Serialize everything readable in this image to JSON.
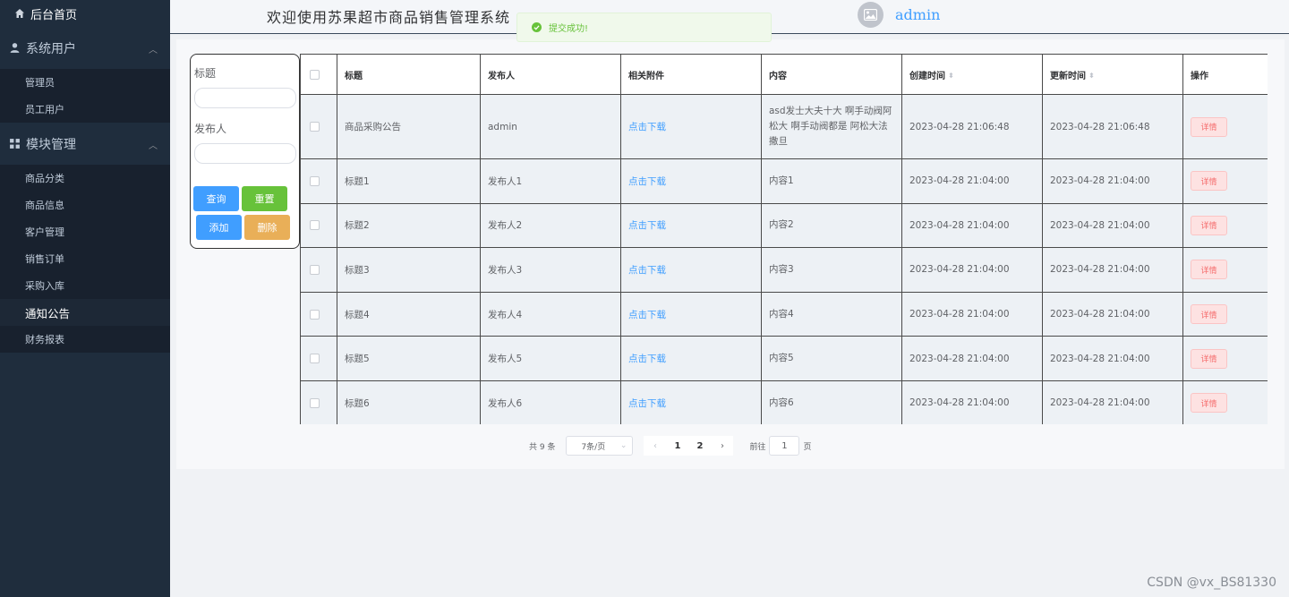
{
  "sidebar": {
    "home": {
      "label": "后台首页",
      "icon": "home-icon"
    },
    "groups": [
      {
        "label": "系统用户",
        "icon": "user-icon",
        "items": [
          "管理员",
          "员工用户"
        ]
      },
      {
        "label": "模块管理",
        "icon": "grid-icon",
        "items": [
          "商品分类",
          "商品信息",
          "客户管理",
          "销售订单",
          "采购入库",
          "通知公告",
          "财务报表"
        ]
      }
    ],
    "active_item": "通知公告"
  },
  "header": {
    "title": "欢迎使用苏果超市商品销售管理系统",
    "username": "admin"
  },
  "toast": {
    "message": "提交成功!",
    "color": "#67c23a"
  },
  "search": {
    "title_label": "标题",
    "publisher_label": "发布人",
    "buttons": {
      "query": "查询",
      "reset": "重置",
      "add": "添加",
      "delete": "删除"
    }
  },
  "table": {
    "headers": [
      "标题",
      "发布人",
      "相关附件",
      "内容",
      "创建时间",
      "更新时间",
      "操作"
    ],
    "rows": [
      {
        "title": "商品采购公告",
        "publisher": "admin",
        "attachment": "点击下载",
        "content": "asd发士大夫十大 啊手动阀阿松大 啊手动阀都是 阿松大法撒旦",
        "created": "2023-04-28 21:06:48",
        "updated": "2023-04-28 21:06:48",
        "action": "详情"
      },
      {
        "title": "标题1",
        "publisher": "发布人1",
        "attachment": "点击下载",
        "content": "内容1",
        "created": "2023-04-28 21:04:00",
        "updated": "2023-04-28 21:04:00",
        "action": "详情"
      },
      {
        "title": "标题2",
        "publisher": "发布人2",
        "attachment": "点击下载",
        "content": "内容2",
        "created": "2023-04-28 21:04:00",
        "updated": "2023-04-28 21:04:00",
        "action": "详情"
      },
      {
        "title": "标题3",
        "publisher": "发布人3",
        "attachment": "点击下载",
        "content": "内容3",
        "created": "2023-04-28 21:04:00",
        "updated": "2023-04-28 21:04:00",
        "action": "详情"
      },
      {
        "title": "标题4",
        "publisher": "发布人4",
        "attachment": "点击下载",
        "content": "内容4",
        "created": "2023-04-28 21:04:00",
        "updated": "2023-04-28 21:04:00",
        "action": "详情"
      },
      {
        "title": "标题5",
        "publisher": "发布人5",
        "attachment": "点击下载",
        "content": "内容5",
        "created": "2023-04-28 21:04:00",
        "updated": "2023-04-28 21:04:00",
        "action": "详情"
      },
      {
        "title": "标题6",
        "publisher": "发布人6",
        "attachment": "点击下载",
        "content": "内容6",
        "created": "2023-04-28 21:04:00",
        "updated": "2023-04-28 21:04:00",
        "action": "详情"
      }
    ]
  },
  "pagination": {
    "total_text": "共 9 条",
    "page_size": "7条/页",
    "pages": [
      "1",
      "2"
    ],
    "current_page": "1",
    "goto_label": "前往",
    "goto_value": "1",
    "page_suffix": "页"
  },
  "watermark": "CSDN @vx_BS81330"
}
